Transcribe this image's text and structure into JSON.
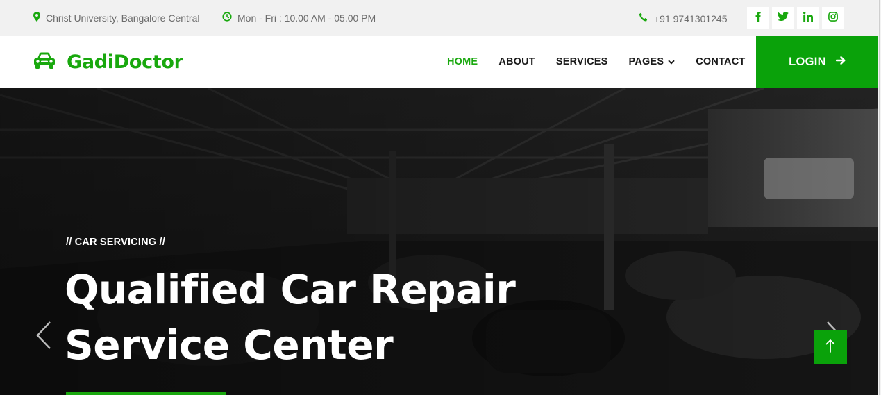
{
  "topbar": {
    "location": "Christ University, Bangalore Central",
    "hours": "Mon - Fri : 10.00 AM - 05.00 PM",
    "phone": "+91 9741301245",
    "social": [
      "facebook-icon",
      "twitter-icon",
      "linkedin-icon",
      "instagram-icon"
    ]
  },
  "navbar": {
    "brand": "GadiDoctor",
    "links": {
      "home": "HOME",
      "about": "ABOUT",
      "services": "SERVICES",
      "pages": "PAGES",
      "contact": "CONTACT"
    },
    "login": "LOGIN"
  },
  "hero": {
    "subtitle": "// CAR SERVICING //",
    "headline_line1": "Qualified Car Repair",
    "headline_line2": "Service Center"
  },
  "colors": {
    "accent": "#19a80e",
    "button": "#0aa20a",
    "topbar_bg": "#f1f1f1"
  }
}
